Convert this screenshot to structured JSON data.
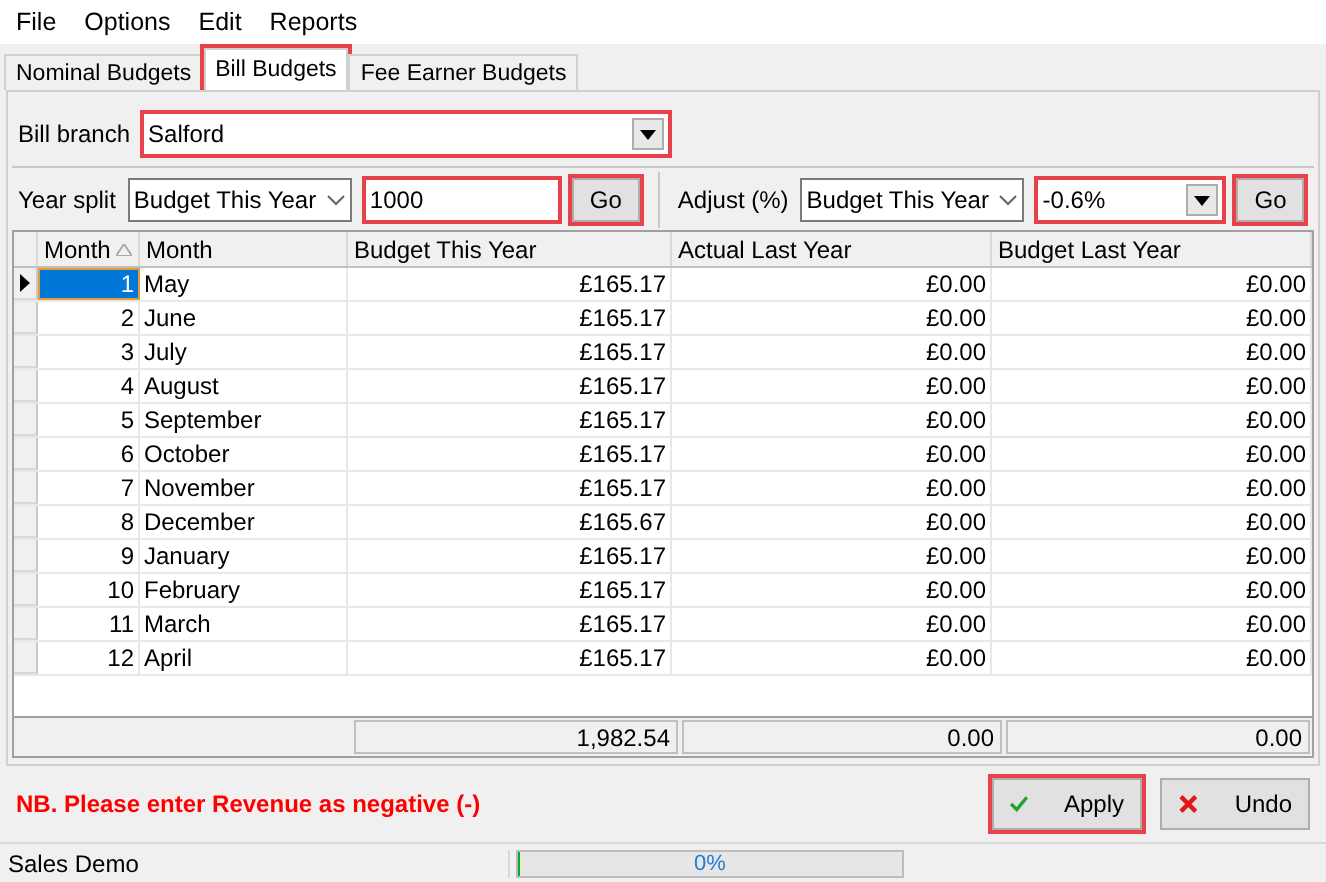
{
  "menu": [
    "File",
    "Options",
    "Edit",
    "Reports"
  ],
  "tabs": [
    {
      "label": "Nominal Budgets",
      "selected": false,
      "highlighted": false
    },
    {
      "label": "Bill Budgets",
      "selected": true,
      "highlighted": true
    },
    {
      "label": "Fee Earner Budgets",
      "selected": false,
      "highlighted": false
    }
  ],
  "bill_branch": {
    "label": "Bill branch",
    "value": "Salford",
    "highlighted": true
  },
  "year_split": {
    "label": "Year split",
    "source": "Budget This Year",
    "value": "1000",
    "highlighted": true,
    "go": {
      "label": "Go",
      "highlighted": true
    }
  },
  "adjust": {
    "label": "Adjust (%)",
    "source": "Budget This Year",
    "value": "-0.6%",
    "highlighted": true,
    "go": {
      "label": "Go",
      "highlighted": true
    }
  },
  "table": {
    "columns": [
      {
        "label": "Month",
        "sorted": true
      },
      {
        "label": "Month",
        "sorted": false
      },
      {
        "label": "Budget This Year",
        "sorted": false
      },
      {
        "label": "Actual Last Year",
        "sorted": false
      },
      {
        "label": "Budget Last Year",
        "sorted": false
      }
    ],
    "rows": [
      {
        "selected": true,
        "cells": [
          "1",
          "May",
          "£165.17",
          "£0.00",
          "£0.00"
        ]
      },
      {
        "selected": false,
        "cells": [
          "2",
          "June",
          "£165.17",
          "£0.00",
          "£0.00"
        ]
      },
      {
        "selected": false,
        "cells": [
          "3",
          "July",
          "£165.17",
          "£0.00",
          "£0.00"
        ]
      },
      {
        "selected": false,
        "cells": [
          "4",
          "August",
          "£165.17",
          "£0.00",
          "£0.00"
        ]
      },
      {
        "selected": false,
        "cells": [
          "5",
          "September",
          "£165.17",
          "£0.00",
          "£0.00"
        ]
      },
      {
        "selected": false,
        "cells": [
          "6",
          "October",
          "£165.17",
          "£0.00",
          "£0.00"
        ]
      },
      {
        "selected": false,
        "cells": [
          "7",
          "November",
          "£165.17",
          "£0.00",
          "£0.00"
        ]
      },
      {
        "selected": false,
        "cells": [
          "8",
          "December",
          "£165.67",
          "£0.00",
          "£0.00"
        ]
      },
      {
        "selected": false,
        "cells": [
          "9",
          "January",
          "£165.17",
          "£0.00",
          "£0.00"
        ]
      },
      {
        "selected": false,
        "cells": [
          "10",
          "February",
          "£165.17",
          "£0.00",
          "£0.00"
        ]
      },
      {
        "selected": false,
        "cells": [
          "11",
          "March",
          "£165.17",
          "£0.00",
          "£0.00"
        ]
      },
      {
        "selected": false,
        "cells": [
          "12",
          "April",
          "£165.17",
          "£0.00",
          "£0.00"
        ]
      }
    ],
    "totals": [
      "1,982.54",
      "0.00",
      "0.00"
    ]
  },
  "note": "NB. Please enter Revenue as negative (-)",
  "buttons": [
    {
      "kind": "apply",
      "label": "Apply",
      "highlighted": true
    },
    {
      "kind": "undo",
      "label": "Undo",
      "highlighted": false
    }
  ],
  "status_bar": {
    "text": "Sales Demo",
    "progress": {
      "label": "0%",
      "level": 0
    }
  }
}
